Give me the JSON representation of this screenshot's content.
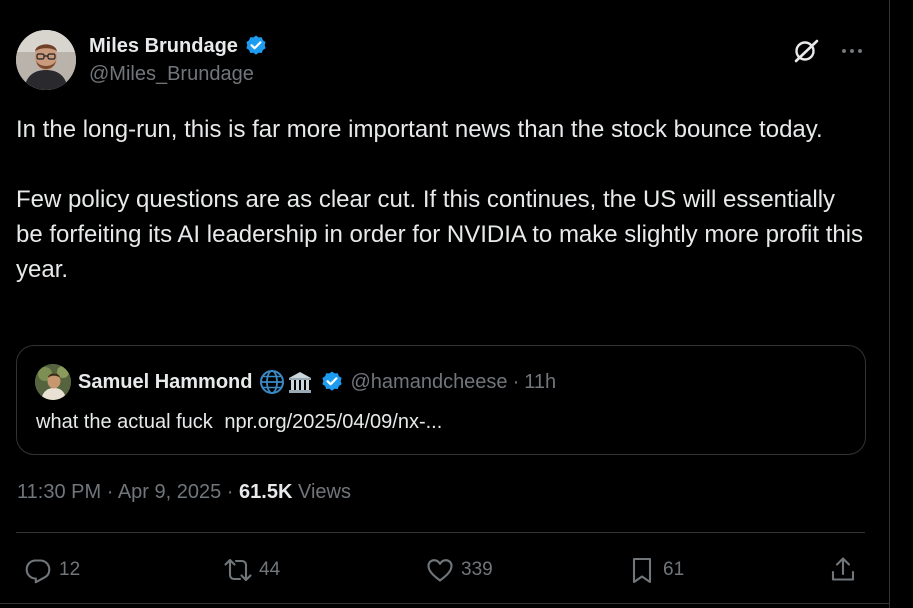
{
  "author": {
    "display_name": "Miles Brundage",
    "handle": "@Miles_Brundage"
  },
  "tweet": {
    "paragraphs": [
      "In the long-run, this is far more important news than the stock bounce today.",
      "Few policy questions are as clear cut. If this continues, the US will essentially be forfeiting its AI leadership in order for NVIDIA to make slightly more profit this year."
    ]
  },
  "quote": {
    "display_name": "Samuel Hammond",
    "handle": "@hamandcheese",
    "separator": "·",
    "time": "11h",
    "text": "what the actual fuck",
    "link": "npr.org/2025/04/09/nx-..."
  },
  "meta": {
    "time": "11:30 PM",
    "separator": "·",
    "date": "Apr 9, 2025",
    "views_count": "61.5K",
    "views_label": "Views"
  },
  "actions": {
    "replies": "12",
    "reposts": "44",
    "likes": "339",
    "bookmarks": "61"
  },
  "icons": {
    "verified": "verified-badge-icon",
    "grok": "grok-icon",
    "more": "more-icon",
    "globe_emoji": "globe-icon",
    "building_emoji": "classical-building-icon",
    "reply": "reply-icon",
    "retweet": "retweet-icon",
    "like": "heart-icon",
    "bookmark": "bookmark-icon",
    "share": "share-icon"
  },
  "colors": {
    "background": "#000000",
    "text": "#e7e9ea",
    "secondary": "#71767b",
    "border": "#2f3336",
    "verified": "#1d9bf0"
  }
}
